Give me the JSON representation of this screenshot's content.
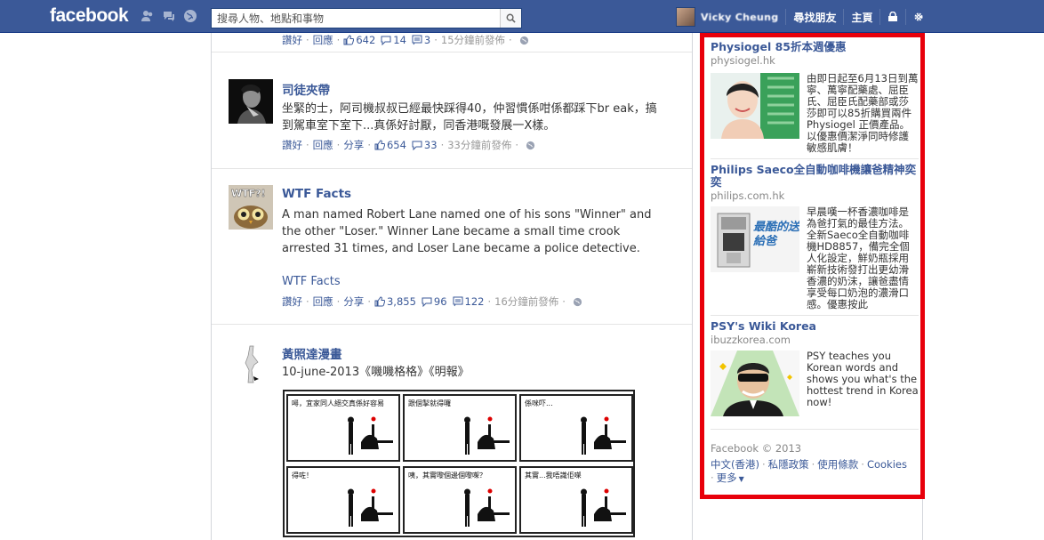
{
  "topbar": {
    "logo": "facebook",
    "search_placeholder": "搜尋人物、地點和事物",
    "user_name": "Vicky Cheung",
    "find_friends": "尋找朋友",
    "home": "主頁"
  },
  "feed": {
    "top_actions": {
      "comment": "讚好",
      "reply": "回應",
      "likes": "642",
      "shares": "14",
      "comments": "3",
      "time": "15分鐘前發佈"
    },
    "stories": [
      {
        "name": "司徒夾帶",
        "message": "坐緊的士，阿司機叔叔已經最快踩得40，仲習慣係咁係都踩下br eak，搞到駕車室下室下...真係好討厭，同香港嘅發展一X樣。",
        "like": "讚好",
        "comment": "回應",
        "share": "分享",
        "likes": "654",
        "shares": "33",
        "time": "33分鐘前發佈"
      },
      {
        "name": "WTF Facts",
        "message": "A man named Robert Lane named one of his sons \"Winner\" and the other \"Loser.\" Winner Lane became a small time crook arrested 31 times, and Loser Lane became a police detective.",
        "link": "WTF Facts",
        "like": "讚好",
        "comment": "回應",
        "share": "分享",
        "likes": "3,855",
        "shares": "96",
        "comments": "122",
        "time": "16分鐘前發佈"
      },
      {
        "name": "黃照達漫畫",
        "message": "10-june-2013《嘰嘰格格》《明報》",
        "comic_captions": [
          "噚，宜家同人絕交真係好容易",
          "跟個掣就得囉",
          "係咪吓...",
          "得咗！",
          "咦，其實嚟個邊個嚟㗎？",
          "其實...我唔識佢㗎"
        ]
      }
    ]
  },
  "ads": [
    {
      "title": "Physiogel 85折本週優惠",
      "domain": "physiogel.hk",
      "body": "由即日起至6月13日到萬寧、萬寧配藥處、屈臣氏、屈臣氏配藥部或莎莎即可以85折購買兩件Physiogel 正價產品。以優惠價潔淨同時修護敏感肌膚！"
    },
    {
      "title": "Philips Saeco全自動咖啡機讓爸精神奕奕",
      "domain": "philips.com.hk",
      "image_text": "最酷的送給爸",
      "body": "早晨嘆一杯香濃咖啡是為爸打氣的最佳方法。全新Saeco全自動咖啡機HD8857，備完全個人化設定，鮮奶瓶採用嶄新技術發打出更幼滑香濃的奶沫，讓爸盡情享受每口奶泡的濃滑口感。優惠按此"
    },
    {
      "title": "PSY's Wiki Korea",
      "domain": "ibuzzkorea.com",
      "body": "PSY teaches you Korean words and shows you what's the hottest trend in Korea now!"
    }
  ],
  "footer": {
    "copyright": "Facebook © 2013",
    "links": [
      "中文(香港)",
      "私隱政策",
      "使用條款",
      "Cookies"
    ],
    "more": "更多"
  },
  "colors": {
    "brand": "#3b5998",
    "highlight_border": "#e8000b"
  }
}
